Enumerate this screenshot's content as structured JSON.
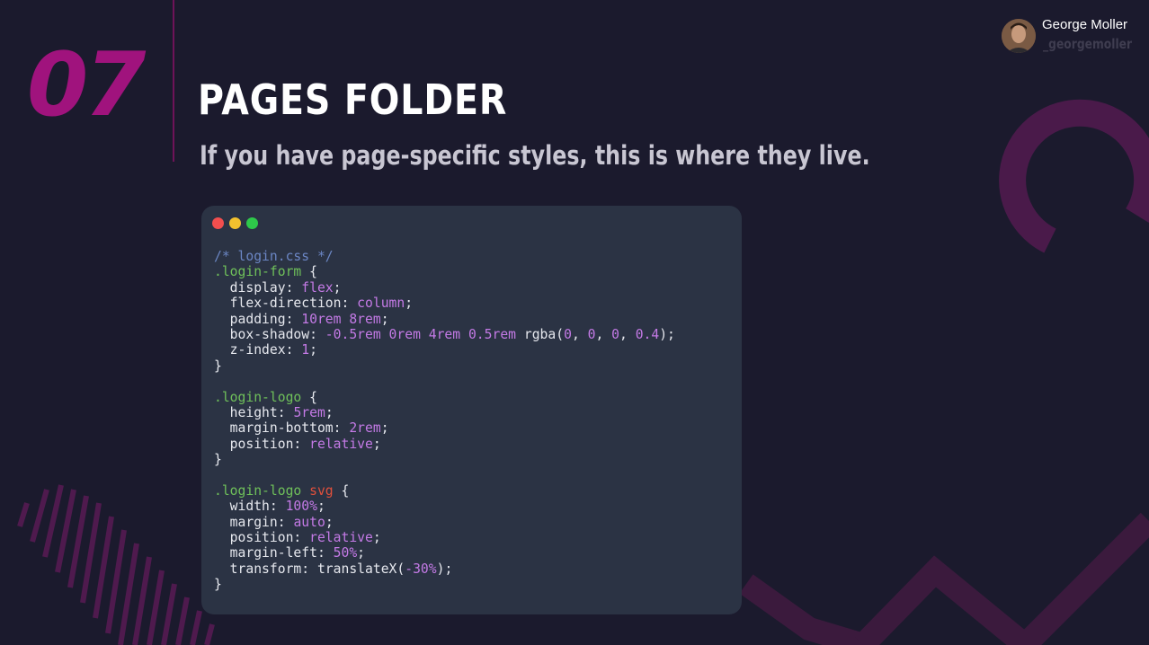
{
  "slide": {
    "number": "07",
    "title": "PAGES FOLDER",
    "subtitle": "If you have page-specific styles, this is where they live."
  },
  "author": {
    "name": "George Moller",
    "handle": "_georgemoller"
  },
  "code_window": {
    "language": "css",
    "lines": [
      [
        [
          "comment",
          "/* login.css */"
        ]
      ],
      [
        [
          "selector",
          ".login-form"
        ],
        [
          "plain",
          " {"
        ]
      ],
      [
        [
          "plain",
          "  display: "
        ],
        [
          "value",
          "flex"
        ],
        [
          "plain",
          ";"
        ]
      ],
      [
        [
          "plain",
          "  flex-direction: "
        ],
        [
          "value",
          "column"
        ],
        [
          "plain",
          ";"
        ]
      ],
      [
        [
          "plain",
          "  padding: "
        ],
        [
          "value",
          "10rem 8rem"
        ],
        [
          "plain",
          ";"
        ]
      ],
      [
        [
          "plain",
          "  box-shadow: "
        ],
        [
          "value",
          "-0.5rem 0rem 4rem 0.5rem"
        ],
        [
          "plain",
          " rgba("
        ],
        [
          "value",
          "0"
        ],
        [
          "plain",
          ", "
        ],
        [
          "value",
          "0"
        ],
        [
          "plain",
          ", "
        ],
        [
          "value",
          "0"
        ],
        [
          "plain",
          ", "
        ],
        [
          "value",
          "0.4"
        ],
        [
          "plain",
          ");"
        ]
      ],
      [
        [
          "plain",
          "  z-index: "
        ],
        [
          "value",
          "1"
        ],
        [
          "plain",
          ";"
        ]
      ],
      [
        [
          "plain",
          "}"
        ]
      ],
      [
        [
          "plain",
          ""
        ]
      ],
      [
        [
          "selector",
          ".login-logo"
        ],
        [
          "plain",
          " {"
        ]
      ],
      [
        [
          "plain",
          "  height: "
        ],
        [
          "value",
          "5rem"
        ],
        [
          "plain",
          ";"
        ]
      ],
      [
        [
          "plain",
          "  margin-bottom: "
        ],
        [
          "value",
          "2rem"
        ],
        [
          "plain",
          ";"
        ]
      ],
      [
        [
          "plain",
          "  position: "
        ],
        [
          "value",
          "relative"
        ],
        [
          "plain",
          ";"
        ]
      ],
      [
        [
          "plain",
          "}"
        ]
      ],
      [
        [
          "plain",
          ""
        ]
      ],
      [
        [
          "selector",
          ".login-logo"
        ],
        [
          "plain",
          " "
        ],
        [
          "element",
          "svg"
        ],
        [
          "plain",
          " {"
        ]
      ],
      [
        [
          "plain",
          "  width: "
        ],
        [
          "value",
          "100%"
        ],
        [
          "plain",
          ";"
        ]
      ],
      [
        [
          "plain",
          "  margin: "
        ],
        [
          "value",
          "auto"
        ],
        [
          "plain",
          ";"
        ]
      ],
      [
        [
          "plain",
          "  position: "
        ],
        [
          "value",
          "relative"
        ],
        [
          "plain",
          ";"
        ]
      ],
      [
        [
          "plain",
          "  margin-left: "
        ],
        [
          "value",
          "50%"
        ],
        [
          "plain",
          ";"
        ]
      ],
      [
        [
          "plain",
          "  transform: translateX("
        ],
        [
          "value",
          "-30%"
        ],
        [
          "plain",
          ");"
        ]
      ],
      [
        [
          "plain",
          "}"
        ]
      ]
    ]
  },
  "colors": {
    "background": "#1b1a2d",
    "accent": "#a0137d",
    "code_background": "#2b3344"
  }
}
